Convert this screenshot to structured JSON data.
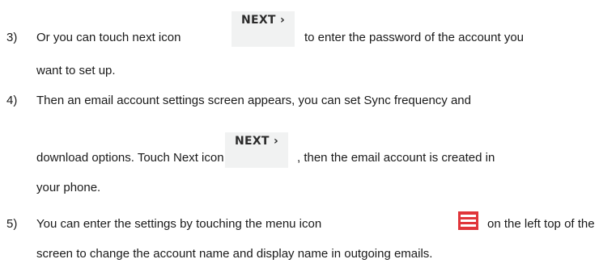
{
  "steps": [
    {
      "number": "3)",
      "lines": [
        "Or you can touch next icon",
        "to enter the password of the account you",
        "want to set up."
      ]
    },
    {
      "number": "4)",
      "lines": [
        "Then an email account settings screen appears, you can set Sync frequency and",
        "download options. Touch Next icon",
        ", then the email account is created in",
        "your phone."
      ]
    },
    {
      "number": "5)",
      "lines": [
        "You can enter the settings by touching the menu icon",
        "on the left top of the",
        "screen to change the account name and display name in outgoing emails."
      ]
    }
  ],
  "next_button": {
    "label": "NEXT",
    "chevron": "›"
  },
  "icons": {
    "menu": "menu-icon",
    "menu_color": "#e0353a"
  }
}
